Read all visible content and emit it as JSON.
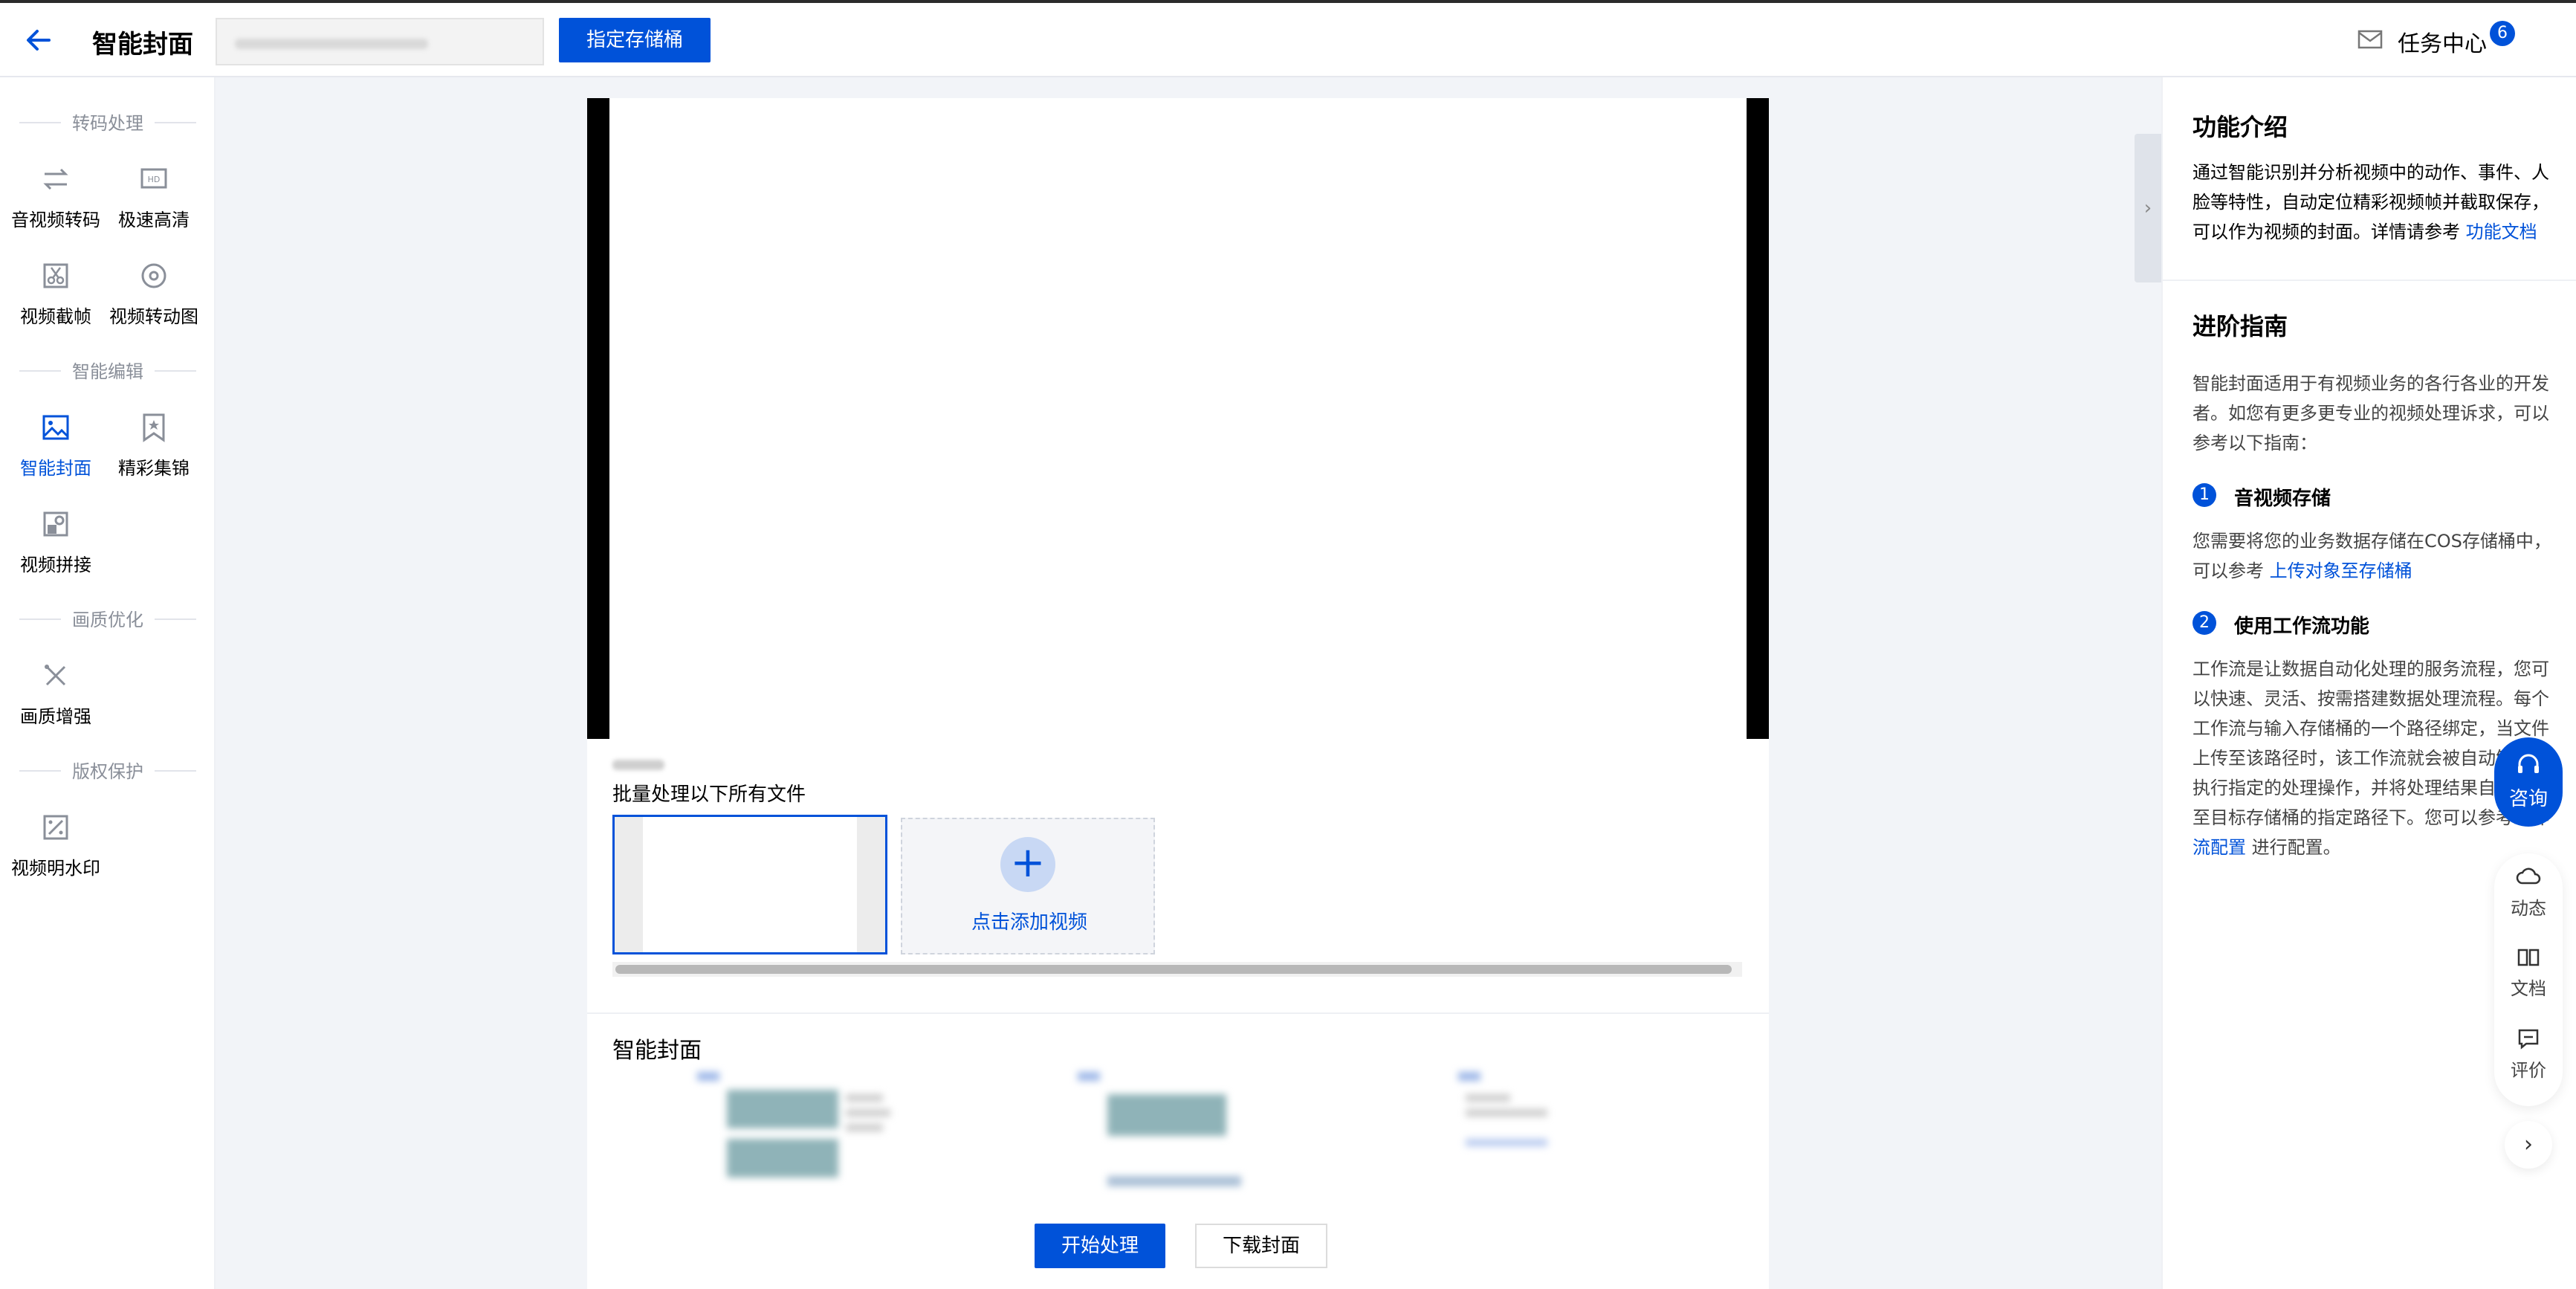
{
  "header": {
    "title": "智能封面",
    "bucket_button": "指定存储桶",
    "task_center": "任务中心",
    "task_count": "6"
  },
  "sidebar": {
    "sections": [
      {
        "title": "转码处理",
        "items": [
          {
            "label": "音视频转码",
            "icon": "transcode-icon"
          },
          {
            "label": "极速高清",
            "icon": "hd-icon"
          },
          {
            "label": "视频截帧",
            "icon": "scissors-icon"
          },
          {
            "label": "视频转动图",
            "icon": "gif-icon"
          }
        ]
      },
      {
        "title": "智能编辑",
        "items": [
          {
            "label": "智能封面",
            "icon": "image-icon",
            "active": true
          },
          {
            "label": "精彩集锦",
            "icon": "bookmark-star-icon"
          },
          {
            "label": "视频拼接",
            "icon": "splice-icon"
          }
        ]
      },
      {
        "title": "画质优化",
        "items": [
          {
            "label": "画质增强",
            "icon": "tools-icon"
          }
        ]
      },
      {
        "title": "版权保护",
        "items": [
          {
            "label": "视频明水印",
            "icon": "watermark-icon"
          }
        ]
      }
    ]
  },
  "main": {
    "batch_label": "批量处理以下所有文件",
    "add_video": "点击添加视频",
    "cover_section_title": "智能封面",
    "start_button": "开始处理",
    "download_button": "下载封面"
  },
  "right_panel": {
    "intro_title": "功能介绍",
    "intro_text": "通过智能识别并分析视频中的动作、事件、人脸等特性，自动定位精彩视频帧并截取保存，可以作为视频的封面。详情请参考",
    "intro_link": "功能文档",
    "guide_title": "进阶指南",
    "guide_text": "智能封面适用于有视频业务的各行各业的开发者。如您有更多更专业的视频处理诉求，可以参考以下指南：",
    "step1_num": "1",
    "step1_title": "音视频存储",
    "step1_text": "您需要将您的业务数据存储在COS存储桶中，可以参考",
    "step1_link": "上传对象至存储桶",
    "step2_num": "2",
    "step2_title": "使用工作流功能",
    "step2_text": "工作流是让数据自动化处理的服务流程，您可以快速、灵活、按需搭建数据处理流程。每个工作流与输入存储桶的一个路径绑定，当文件上传至该路径时，该工作流就会被自动触发，执行指定的处理操作，并将处理结果自动保存至目标存储桶的指定路径下。您可以参考工作",
    "step2_link": "流配置",
    "step2_tail": "进行配置。"
  },
  "float": {
    "consult": "咨询",
    "news": "动态",
    "docs": "文档",
    "review": "评价"
  },
  "colors": {
    "accent": "#0052d9"
  }
}
